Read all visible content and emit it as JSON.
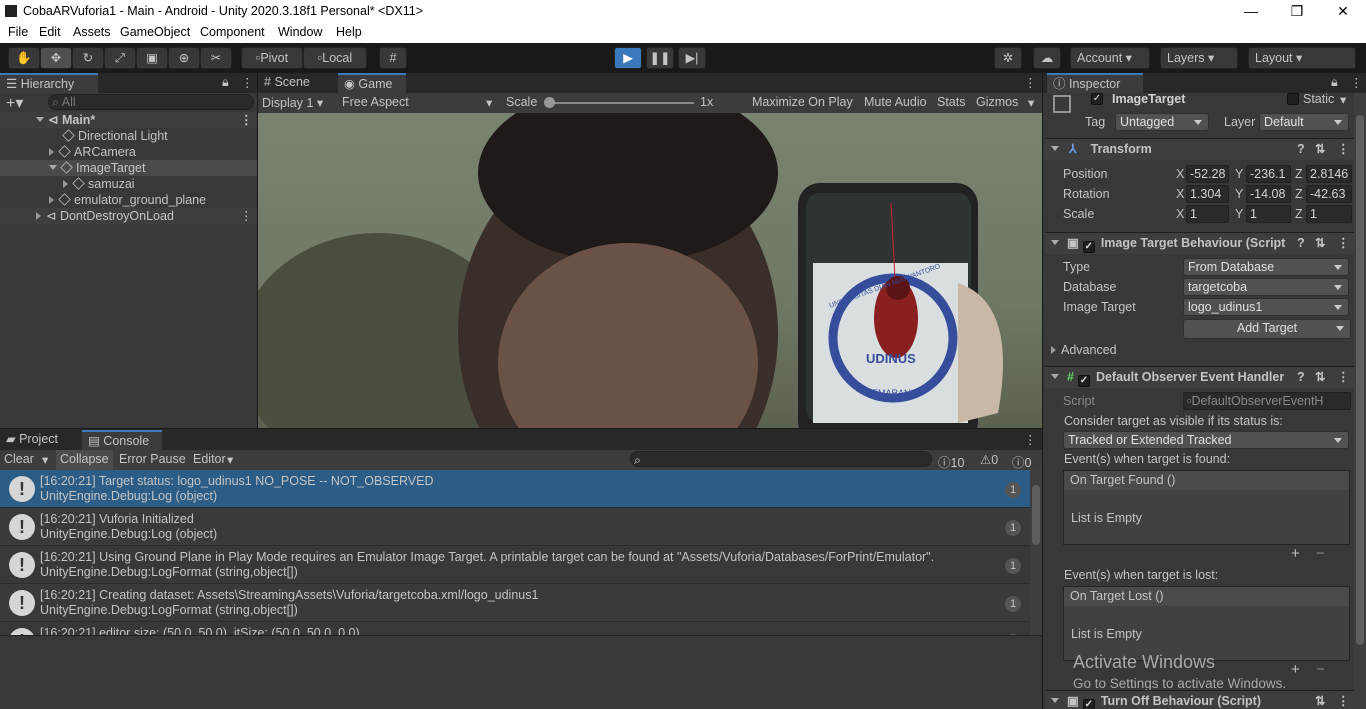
{
  "title": "CobaARVuforia1 - Main - Android - Unity 2020.3.18f1 Personal* <DX11>",
  "window_buttons": {
    "minimize": "—",
    "maximize": "❐",
    "close": "✕"
  },
  "menu": [
    "File",
    "Edit",
    "Assets",
    "GameObject",
    "Component",
    "Window",
    "Help"
  ],
  "toolbar": {
    "pivot": "Pivot",
    "local": "Local",
    "account": "Account",
    "layers": "Layers",
    "layout": "Layout"
  },
  "hierarchy": {
    "tab": "Hierarchy",
    "search_placeholder": "All",
    "items": [
      "Main*",
      "Directional Light",
      "ARCamera",
      "ImageTarget",
      "samuzai",
      "emulator_ground_plane",
      "DontDestroyOnLoad"
    ]
  },
  "game": {
    "tabs": [
      "Scene",
      "Game"
    ],
    "display": "Display 1",
    "aspect": "Free Aspect",
    "scale_label": "Scale",
    "scale_value": "1x",
    "maximize": "Maximize On Play",
    "mute": "Mute Audio",
    "stats": "Stats",
    "gizmos": "Gizmos",
    "marker_text_top": "UNIVERSITAS DIAN NUSWANTORO",
    "marker_text_mid": "UDINUS",
    "marker_text_bot": "SEMARANG"
  },
  "console": {
    "tabs": [
      "Project",
      "Console"
    ],
    "clear": "Clear",
    "collapse": "Collapse",
    "error_pause": "Error Pause",
    "editor": "Editor",
    "count_log": "10",
    "count_warn": "0",
    "count_err": "0",
    "rows": [
      {
        "l1": "[16:20:21] Target status: logo_udinus1 NO_POSE -- NOT_OBSERVED",
        "l2": "UnityEngine.Debug:Log (object)",
        "count": "1"
      },
      {
        "l1": "[16:20:21] Vuforia Initialized",
        "l2": "UnityEngine.Debug:Log (object)",
        "count": "1"
      },
      {
        "l1": "[16:20:21] Using Ground Plane in Play Mode requires an Emulator Image Target. A printable target can be found at \"Assets/Vuforia/Databases/ForPrint/Emulator\".",
        "l2": "UnityEngine.Debug:LogFormat (string,object[])",
        "count": "1"
      },
      {
        "l1": "[16:20:21] Creating dataset: Assets\\StreamingAssets\\Vuforia/targetcoba.xml/logo_udinus1",
        "l2": "UnityEngine.Debug:LogFormat (string,object[])",
        "count": "1"
      },
      {
        "l1": "[16:20:21] editor size: (50.0, 50.0), itSize: (50.0, 50.0, 0.0)",
        "l2": "",
        "count": ""
      }
    ]
  },
  "inspector": {
    "tab": "Inspector",
    "object_name": "ImageTarget",
    "static": "Static",
    "tag_label": "Tag",
    "tag": "Untagged",
    "layer_label": "Layer",
    "layer": "Default",
    "transform": {
      "title": "Transform",
      "position_label": "Position",
      "rotation_label": "Rotation",
      "scale_label": "Scale",
      "px": "-52.28",
      "py": "-236.1",
      "pz": "2.8146",
      "rx": "1.304",
      "ry": "-14.08",
      "rz": "-42.63",
      "sx": "1",
      "sy": "1",
      "sz": "1"
    },
    "itb": {
      "title": "Image Target Behaviour (Script",
      "type_label": "Type",
      "type": "From Database",
      "db_label": "Database",
      "db": "targetcoba",
      "it_label": "Image Target",
      "it": "logo_udinus1",
      "add": "Add Target",
      "advanced": "Advanced"
    },
    "doeh": {
      "title": "Default Observer Event Handler",
      "script_label": "Script",
      "script": "DefaultObserverEventH",
      "consider": "Consider target as visible if its status is:",
      "status": "Tracked or Extended Tracked",
      "found_label": "Event(s) when target is found:",
      "found_header": "On Target Found ()",
      "found_empty": "List is Empty",
      "lost_label": "Event(s) when target is lost:",
      "lost_header": "On Target Lost ()",
      "lost_empty": "List is Empty"
    },
    "turnoff": "Turn Off Behaviour (Script)",
    "activate1": "Activate Windows",
    "activate2": "Go to Settings to activate Windows."
  },
  "colors": {
    "accent": "#3a79bb",
    "selected": "#2c5d87"
  }
}
